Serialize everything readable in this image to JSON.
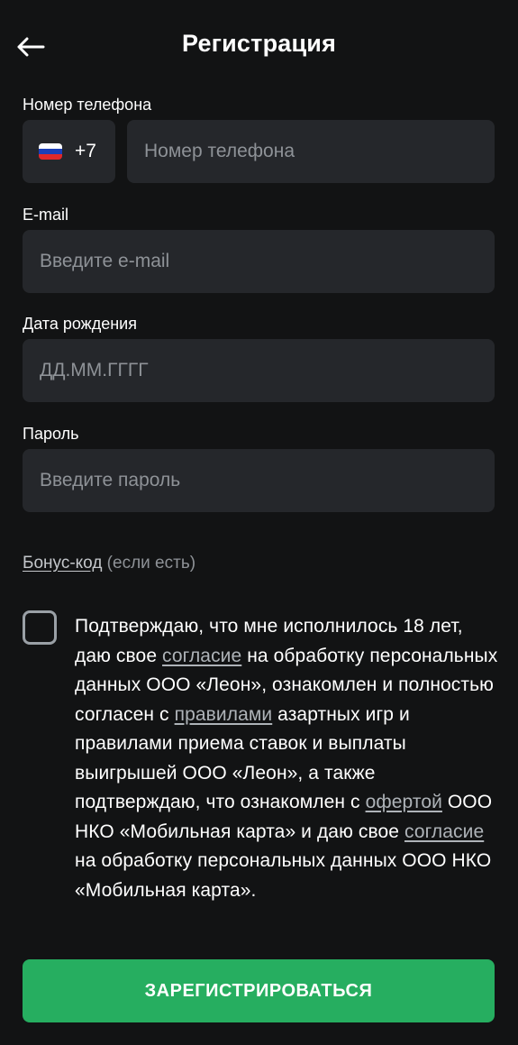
{
  "header": {
    "back_icon": "arrow-left-icon",
    "title": "Регистрация"
  },
  "phone": {
    "label": "Номер телефона",
    "country_flag": "russia-flag-icon",
    "dial_code": "+7",
    "placeholder": "Номер телефона",
    "value": ""
  },
  "email": {
    "label": "E-mail",
    "placeholder": "Введите e-mail",
    "value": ""
  },
  "birthdate": {
    "label": "Дата рождения",
    "placeholder": "ДД.ММ.ГГГГ",
    "value": ""
  },
  "password": {
    "label": "Пароль",
    "placeholder": "Введите пароль",
    "value": ""
  },
  "bonus": {
    "link": "Бонус-код",
    "suffix": " (если есть)"
  },
  "consent": {
    "checked": false,
    "t1": "Подтверждаю, что мне исполнилось 18 лет, даю свое ",
    "l1": "согласие",
    "t2": " на обработку персональных данных ООО «Леон», ознакомлен и полностью согласен с ",
    "l2": "правилами",
    "t3": " азартных игр и правилами приема ставок и выплаты выигрышей ООО «Леон», а также подтверждаю, что ознакомлен с ",
    "l3": "офертой",
    "t4": " ООО НКО «Мобильная карта» и даю свое ",
    "l4": "согласие",
    "t5": " на обработку персональных данных ООО НКО «Мобильная карта»."
  },
  "submit": {
    "label": "ЗАРЕГИСТРИРОВАТЬСЯ"
  },
  "colors": {
    "background": "#121314",
    "input_bg": "#25272b",
    "placeholder": "#8e9297",
    "accent_green": "#26ae60",
    "link": "#aeb3b8"
  }
}
